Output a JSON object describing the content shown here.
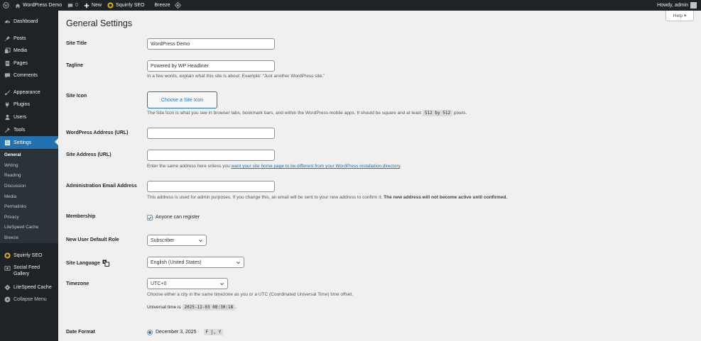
{
  "admin_bar": {
    "site_name": "WordPress Demo",
    "comments_count": "0",
    "new_label": "New",
    "squirrly_label": "Squirrly SEO",
    "breeze_label": "Breeze",
    "howdy": "Howdy, admin"
  },
  "sidebar": {
    "items": [
      {
        "label": "Dashboard",
        "icon": "dashboard-icon"
      },
      {
        "label": "Posts",
        "icon": "pin-icon"
      },
      {
        "label": "Media",
        "icon": "media-icon"
      },
      {
        "label": "Pages",
        "icon": "pages-icon"
      },
      {
        "label": "Comments",
        "icon": "comments-icon"
      },
      {
        "label": "Appearance",
        "icon": "brush-icon"
      },
      {
        "label": "Plugins",
        "icon": "plugin-icon"
      },
      {
        "label": "Users",
        "icon": "users-icon"
      },
      {
        "label": "Tools",
        "icon": "wrench-icon"
      },
      {
        "label": "Settings",
        "icon": "settings-icon"
      },
      {
        "label": "Squirrly SEO",
        "icon": "squirrly-icon"
      },
      {
        "label": "Social Feed Gallery",
        "label_line1": "Social Feed",
        "label_line2": "Gallery",
        "icon": "gallery-icon"
      },
      {
        "label": "LiteSpeed Cache",
        "icon": "litespeed-icon"
      },
      {
        "label": "Collapse Menu",
        "icon": "collapse-icon"
      }
    ],
    "submenu": [
      "General",
      "Writing",
      "Reading",
      "Discussion",
      "Media",
      "Permalinks",
      "Privacy",
      "LiteSpeed Cache",
      "Breeze"
    ]
  },
  "help_label": "Help ▾",
  "page_title": "General Settings",
  "fields": {
    "site_title": {
      "label": "Site Title",
      "value": "WordPress Demo"
    },
    "tagline": {
      "label": "Tagline",
      "value": "Powered by WP Headliner",
      "description": "In a few words, explain what this site is about. Example: “Just another WordPress site.”"
    },
    "site_icon": {
      "label": "Site Icon",
      "button": "Choose a Site Icon",
      "desc_before": "The Site Icon is what you see in browser tabs, bookmark bars, and within the WordPress mobile apps. It should be square and at least",
      "code": "512 by 512",
      "desc_after": "pixels."
    },
    "wp_address": {
      "label": "WordPress Address (URL)",
      "value": ""
    },
    "site_address": {
      "label": "Site Address (URL)",
      "value": "",
      "desc_before": "Enter the same address here unless you",
      "link": "want your site home page to be different from your WordPress installation directory",
      "desc_after": "."
    },
    "admin_email": {
      "label": "Administration Email Address",
      "value": "",
      "desc_plain": "This address is used for admin purposes. If you change this, an email will be sent to your new address to confirm it.",
      "desc_bold": "The new address will not become active until confirmed."
    },
    "membership": {
      "label": "Membership",
      "checkbox_label": "Anyone can register",
      "checked": true
    },
    "default_role": {
      "label": "New User Default Role",
      "selected": "Subscriber"
    },
    "site_language": {
      "label": "Site Language",
      "selected": "English (United States)"
    },
    "timezone": {
      "label": "Timezone",
      "selected": "UTC+0",
      "description": "Choose either a city in the same timezone as you or a UTC (Coordinated Universal Time) time offset.",
      "universal_before": "Universal time is",
      "universal_code": "2025-12-03 08:30:18",
      "universal_after": "."
    },
    "date_format": {
      "label": "Date Format",
      "option_label": "December 3, 2025",
      "option_code": "F j, Y"
    }
  },
  "colors": {
    "accent": "#2271b1",
    "menu_bg": "#1d2327",
    "submenu_bg": "#2c3338",
    "page_bg": "#f0f0f1"
  }
}
